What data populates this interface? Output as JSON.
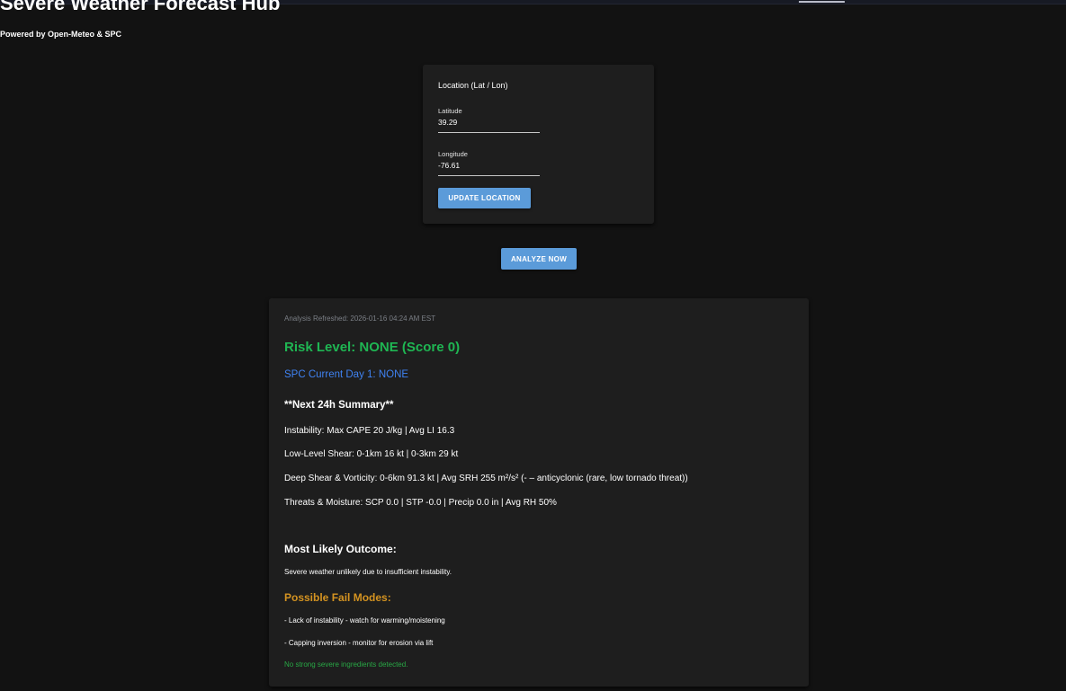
{
  "header": {
    "title": "Severe Weather Forecast Hub",
    "subtitle": "Powered by Open-Meteo & SPC"
  },
  "location": {
    "heading": "Location (Lat / Lon)",
    "latitude_label": "Latitude",
    "latitude_value": "39.29",
    "longitude_label": "Longitude",
    "longitude_value": "-76.61",
    "update_label": "UPDATE LOCATION"
  },
  "analyze_label": "ANALYZE NOW",
  "analysis": {
    "refreshed": "Analysis Refreshed: 2026-01-16 04:24 AM EST",
    "risk_level": "Risk Level: NONE (Score 0)",
    "spc_day1": "SPC Current Day 1: NONE",
    "summary_heading": "**Next 24h Summary**",
    "metrics": {
      "instability": "Instability: Max CAPE 20 J/kg | Avg LI 16.3",
      "low_level_shear": "Low-Level Shear: 0-1km 16 kt | 0-3km 29 kt",
      "deep_shear": "Deep Shear & Vorticity: 0-6km 91.3 kt | Avg SRH 255 m²/s² (- – anticyclonic (rare, low tornado threat))",
      "threats": "Threats & Moisture: SCP 0.0 | STP -0.0 | Precip 0.0 in | Avg RH 50%"
    },
    "outcome_heading": "Most Likely Outcome:",
    "outcome_text": "Severe weather unlikely due to insufficient instability.",
    "fail_heading": "Possible Fail Modes:",
    "fail_modes": [
      "- Lack of instability - watch for warming/moistening",
      "- Capping inversion - monitor for erosion via lift"
    ],
    "ingredients_note": "No strong severe ingredients detected."
  },
  "colors": {
    "background": "#121212",
    "card": "#1e1e1e",
    "button": "#5b9bd9",
    "risk_green": "#1fb653",
    "spc_blue": "#3f82f2",
    "fail_orange": "#d49321",
    "note_green": "#28a845",
    "muted_text": "#7b7f86"
  }
}
